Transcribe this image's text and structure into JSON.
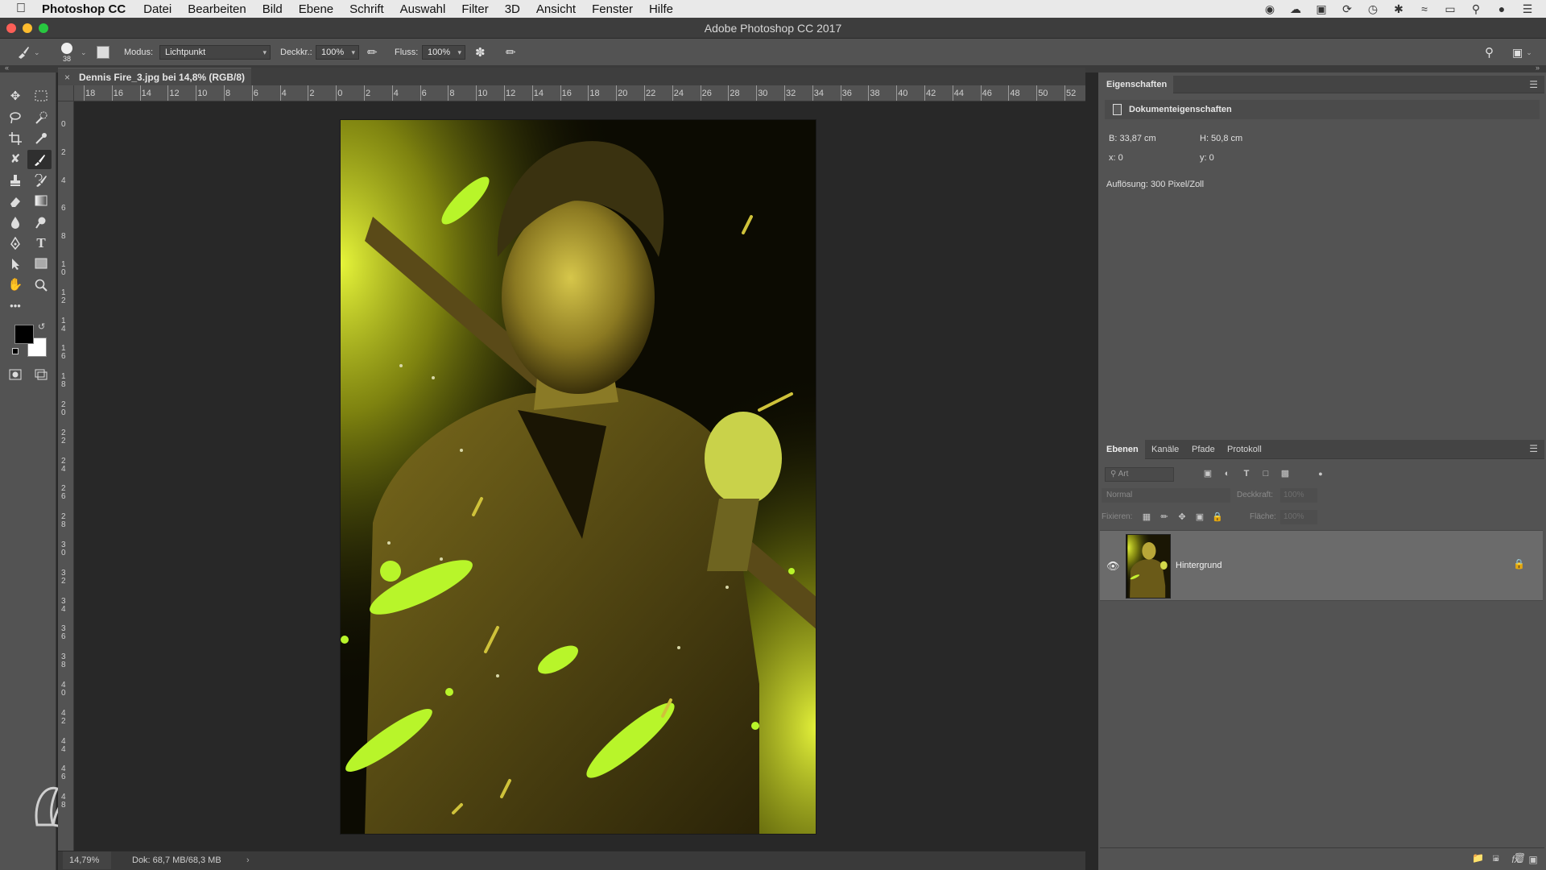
{
  "menubar": {
    "app": "Photoshop CC",
    "items": [
      "Datei",
      "Bearbeiten",
      "Bild",
      "Ebene",
      "Schrift",
      "Auswahl",
      "Filter",
      "3D",
      "Ansicht",
      "Fenster",
      "Hilfe"
    ]
  },
  "window": {
    "title": "Adobe Photoshop CC 2017"
  },
  "options": {
    "brush_size": "38",
    "mode_label": "Modus:",
    "mode_value": "Lichtpunkt",
    "opacity_label": "Deckkr.:",
    "opacity_value": "100%",
    "flow_label": "Fluss:",
    "flow_value": "100%"
  },
  "document": {
    "tab_title": "Dennis Fire_3.jpg bei 14,8% (RGB/8)",
    "tab_close": "×"
  },
  "ruler": {
    "h_labels": [
      "18",
      "16",
      "14",
      "12",
      "10",
      "8",
      "6",
      "4",
      "2",
      "0",
      "2",
      "4",
      "6",
      "8",
      "10",
      "12",
      "14",
      "16",
      "18",
      "20",
      "22",
      "24",
      "26",
      "28",
      "30",
      "32",
      "34",
      "36",
      "38",
      "40",
      "42",
      "44",
      "46",
      "48",
      "50",
      "52"
    ],
    "v_labels": [
      "0",
      "2",
      "4",
      "6",
      "8",
      "1\n0",
      "1\n2",
      "1\n4",
      "1\n6",
      "1\n8",
      "2\n0",
      "2\n2",
      "2\n4",
      "2\n6",
      "2\n8",
      "3\n0",
      "3\n2",
      "3\n4",
      "3\n6",
      "3\n8",
      "4\n0",
      "4\n2",
      "4\n4",
      "4\n6",
      "4\n8"
    ]
  },
  "status": {
    "zoom": "14,79%",
    "doc": "Dok: 68,7 MB/68,3 MB",
    "arrow": "›"
  },
  "properties": {
    "tab": "Eigenschaften",
    "section": "Dokumenteigenschaften",
    "width": "B: 33,87 cm",
    "height": "H: 50,8 cm",
    "x": "x: 0",
    "y": "y: 0",
    "resolution": "Auflösung: 300 Pixel/Zoll"
  },
  "layers": {
    "tabs": [
      "Ebenen",
      "Kanäle",
      "Pfade",
      "Protokoll"
    ],
    "filter_placeholder": "Art",
    "blend_mode": "Normal",
    "opacity_label": "Deckkraft:",
    "opacity_value": "100%",
    "lock_label": "Fixieren:",
    "fill_label": "Fläche:",
    "fill_value": "100%",
    "items": [
      {
        "name": "Hintergrund"
      }
    ]
  },
  "colors": {
    "foreground": "#000000",
    "background": "#ffffff",
    "accent_yellow": "#e5f23a"
  }
}
